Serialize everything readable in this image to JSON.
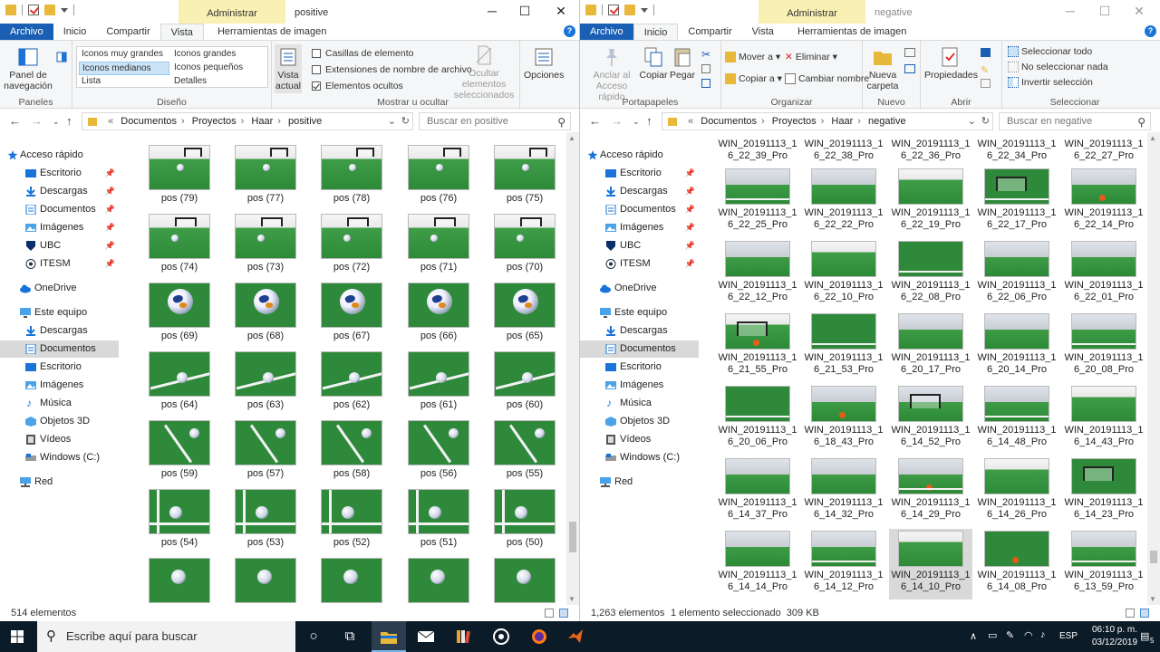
{
  "left": {
    "window_title": "positive",
    "manage_tab": "Administrar",
    "controls": {
      "minimize": "─",
      "maximize": "☐",
      "close": "✕"
    },
    "tabs": [
      "Archivo",
      "Inicio",
      "Compartir",
      "Vista",
      "Herramientas de imagen"
    ],
    "help": "?",
    "ribbon": {
      "panels": {
        "panel_nav": "Panel de navegación",
        "label": "Paneles"
      },
      "layout": {
        "items": [
          "Iconos muy grandes",
          "Iconos grandes",
          "Iconos medianos",
          "Iconos pequeños",
          "Lista",
          "Detalles"
        ],
        "label": "Diseño"
      },
      "view": {
        "current_view": "Vista actual"
      },
      "show": {
        "checkboxes": "Casillas de elemento",
        "extensions": "Extensiones de nombre de archivo",
        "hidden": "Elementos ocultos",
        "hide_selected": "Ocultar elementos seleccionados",
        "label": "Mostrar u ocultar"
      },
      "options": "Opciones"
    },
    "address": {
      "prefix": "«",
      "crumbs": [
        "Documentos",
        "Proyectos",
        "Haar",
        "positive"
      ]
    },
    "search_placeholder": "Buscar en positive",
    "nav": {
      "quick_access": "Acceso rápido",
      "quick": [
        "Escritorio",
        "Descargas",
        "Documentos",
        "Imágenes",
        "UBC",
        "ITESM"
      ],
      "onedrive": "OneDrive",
      "this_pc": "Este equipo",
      "pc": [
        "Descargas",
        "Documentos",
        "Escritorio",
        "Imágenes",
        "Música",
        "Objetos 3D",
        "Vídeos",
        "Windows (C:)"
      ],
      "network": "Red",
      "selected": "Documentos"
    },
    "items": [
      [
        "pos (79)",
        "pos (77)",
        "pos (78)",
        "pos (76)",
        "pos (75)"
      ],
      [
        "pos (74)",
        "pos (73)",
        "pos (72)",
        "pos (71)",
        "pos (70)"
      ],
      [
        "pos (69)",
        "pos (68)",
        "pos (67)",
        "pos (66)",
        "pos (65)"
      ],
      [
        "pos (64)",
        "pos (63)",
        "pos (62)",
        "pos (61)",
        "pos (60)"
      ],
      [
        "pos (59)",
        "pos (57)",
        "pos (58)",
        "pos (56)",
        "pos (55)"
      ],
      [
        "pos (54)",
        "pos (53)",
        "pos (52)",
        "pos (51)",
        "pos (50)"
      ],
      [
        "",
        "",
        "",
        "",
        ""
      ]
    ],
    "status": "514 elementos"
  },
  "right": {
    "window_title": "negative",
    "manage_tab": "Administrar",
    "controls": {
      "minimize": "─",
      "maximize": "☐",
      "close": "✕"
    },
    "tabs": [
      "Archivo",
      "Inicio",
      "Compartir",
      "Vista",
      "Herramientas de imagen"
    ],
    "help": "?",
    "ribbon": {
      "clipboard": {
        "pin": "Anclar al Acceso rápido",
        "copy": "Copiar",
        "paste": "Pegar",
        "label": "Portapapeles"
      },
      "organize": {
        "move": "Mover a",
        "copy_to": "Copiar a",
        "delete": "Eliminar",
        "rename": "Cambiar nombre",
        "label": "Organizar"
      },
      "new": {
        "folder": "Nueva carpeta",
        "label": "Nuevo"
      },
      "open": {
        "props": "Propiedades",
        "label": "Abrir"
      },
      "select": {
        "all": "Seleccionar todo",
        "none": "No seleccionar nada",
        "invert": "Invertir selección",
        "label": "Seleccionar"
      }
    },
    "address": {
      "prefix": "«",
      "crumbs": [
        "Documentos",
        "Proyectos",
        "Haar",
        "negative"
      ]
    },
    "search_placeholder": "Buscar en negative",
    "nav": {
      "quick_access": "Acceso rápido",
      "quick": [
        "Escritorio",
        "Descargas",
        "Documentos",
        "Imágenes",
        "UBC",
        "ITESM"
      ],
      "onedrive": "OneDrive",
      "this_pc": "Este equipo",
      "pc": [
        "Descargas",
        "Documentos",
        "Escritorio",
        "Imágenes",
        "Música",
        "Objetos 3D",
        "Vídeos",
        "Windows (C:)"
      ],
      "network": "Red",
      "selected": "Documentos"
    },
    "top_labels": [
      "WIN_20191113_1 6_22_39_Pro",
      "WIN_20191113_1 6_22_38_Pro",
      "WIN_20191113_1 6_22_36_Pro",
      "WIN_20191113_1 6_22_34_Pro",
      "WIN_20191113_1 6_22_27_Pro"
    ],
    "items": [
      [
        "WIN_20191113_1 6_22_25_Pro",
        "WIN_20191113_1 6_22_22_Pro",
        "WIN_20191113_1 6_22_19_Pro",
        "WIN_20191113_1 6_22_17_Pro",
        "WIN_20191113_1 6_22_14_Pro"
      ],
      [
        "WIN_20191113_1 6_22_12_Pro",
        "WIN_20191113_1 6_22_10_Pro",
        "WIN_20191113_1 6_22_08_Pro",
        "WIN_20191113_1 6_22_06_Pro",
        "WIN_20191113_1 6_22_01_Pro"
      ],
      [
        "WIN_20191113_1 6_21_55_Pro",
        "WIN_20191113_1 6_21_53_Pro",
        "WIN_20191113_1 6_20_17_Pro",
        "WIN_20191113_1 6_20_14_Pro",
        "WIN_20191113_1 6_20_08_Pro"
      ],
      [
        "WIN_20191113_1 6_20_06_Pro",
        "WIN_20191113_1 6_18_43_Pro",
        "WIN_20191113_1 6_14_52_Pro",
        "WIN_20191113_1 6_14_48_Pro",
        "WIN_20191113_1 6_14_43_Pro"
      ],
      [
        "WIN_20191113_1 6_14_37_Pro",
        "WIN_20191113_1 6_14_32_Pro",
        "WIN_20191113_1 6_14_29_Pro",
        "WIN_20191113_1 6_14_26_Pro",
        "WIN_20191113_1 6_14_23_Pro"
      ],
      [
        "WIN_20191113_1 6_14_14_Pro",
        "WIN_20191113_1 6_14_12_Pro",
        "WIN_20191113_1 6_14_10_Pro",
        "WIN_20191113_1 6_14_08_Pro",
        "WIN_20191113_1 6_13_59_Pro"
      ]
    ],
    "selected_item": "WIN_20191113_1 6_14_10_Pro",
    "status": "1,263 elementos",
    "status_selection": "1 elemento seleccionado  309 KB"
  },
  "taskbar": {
    "search_placeholder": "Escribe aquí para buscar",
    "language": "ESP",
    "time": "06:10 p. m.",
    "date": "03/12/2019",
    "notifications": "5"
  },
  "colors": {
    "file_tab": "#1a5fb4",
    "manage_tab": "#f9f1b4",
    "selection": "#cce4f7",
    "taskbar": "#0c1b28"
  }
}
